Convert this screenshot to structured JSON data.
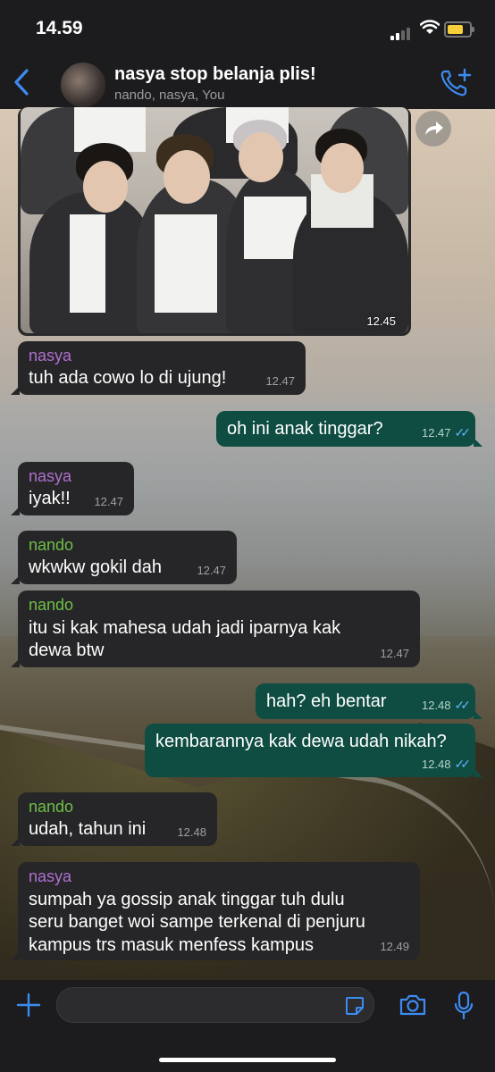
{
  "status": {
    "time": "14.59"
  },
  "chat": {
    "title": "nasya stop belanja plis!",
    "members": "nando, nasya, You"
  },
  "image_message": {
    "time": "12.45"
  },
  "messages": [
    {
      "sender": "nasya",
      "lines": [
        "tuh ada cowo lo di ujung!"
      ],
      "time": "12.47"
    },
    {
      "lines": [
        "oh ini anak tinggar?"
      ],
      "time": "12.47"
    },
    {
      "sender": "nasya",
      "lines": [
        "iyak!!"
      ],
      "time": "12.47"
    },
    {
      "sender": "nando",
      "lines": [
        "wkwkw gokil dah"
      ],
      "time": "12.47"
    },
    {
      "sender": "nando",
      "lines": [
        "itu si kak mahesa udah jadi iparnya kak",
        "dewa btw"
      ],
      "time": "12.47"
    },
    {
      "lines": [
        "hah? eh bentar"
      ],
      "time": "12.48"
    },
    {
      "lines": [
        "kembarannya kak dewa udah nikah?"
      ],
      "time": "12.48"
    },
    {
      "sender": "nando",
      "lines": [
        "udah, tahun ini"
      ],
      "time": "12.48"
    },
    {
      "sender": "nasya",
      "lines": [
        "sumpah ya gossip anak tinggar tuh dulu",
        "seru banget woi sampe terkenal di penjuru",
        "kampus trs masuk menfess kampus"
      ],
      "time": "12.49"
    }
  ],
  "colors": {
    "nasya": "#b06fd0",
    "nando": "#6fbf46",
    "accent": "#3d8bf2"
  },
  "icons": [
    "back-chevron-icon",
    "add-call-icon",
    "share-icon",
    "plus-icon",
    "sticker-icon",
    "camera-icon",
    "mic-icon"
  ]
}
